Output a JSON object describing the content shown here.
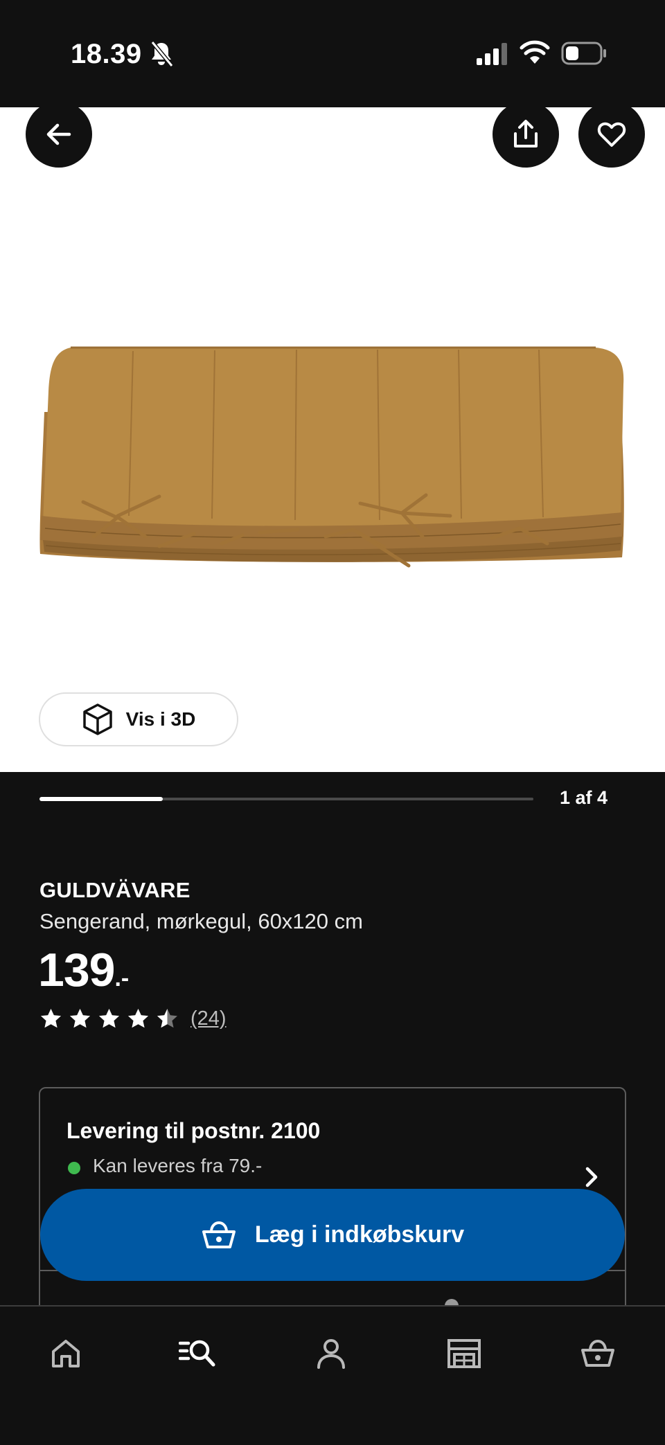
{
  "status_bar": {
    "time": "18.39",
    "icons": [
      "bell-off-icon",
      "signal-icon",
      "wifi-icon",
      "battery-icon"
    ]
  },
  "header_actions": {
    "icons": [
      "arrow-left-icon",
      "share-icon",
      "heart-icon"
    ]
  },
  "gallery": {
    "view_3d_label": "Vis i 3D",
    "page_indicator": "1 af 4",
    "current_page": 1,
    "total_pages": 4
  },
  "product": {
    "name": "GULDVÄVARE",
    "description": "Sengerand, mørkegul, 60x120 cm",
    "price": "139",
    "price_suffix": ".-",
    "rating": 4.5,
    "review_count": "(24)"
  },
  "delivery": {
    "title": "Levering til postnr. 2100",
    "status_text": "Kan leveres fra 79.-",
    "status_color": "#3fb94f"
  },
  "cart_button": {
    "label": "Læg i indkøbskurv",
    "color": "#0058a3"
  },
  "bottom_nav": {
    "items": [
      "home-icon",
      "search-icon",
      "profile-icon",
      "store-icon",
      "cart-icon"
    ]
  },
  "colors": {
    "background": "#111111",
    "product_color": "#b88a45"
  }
}
